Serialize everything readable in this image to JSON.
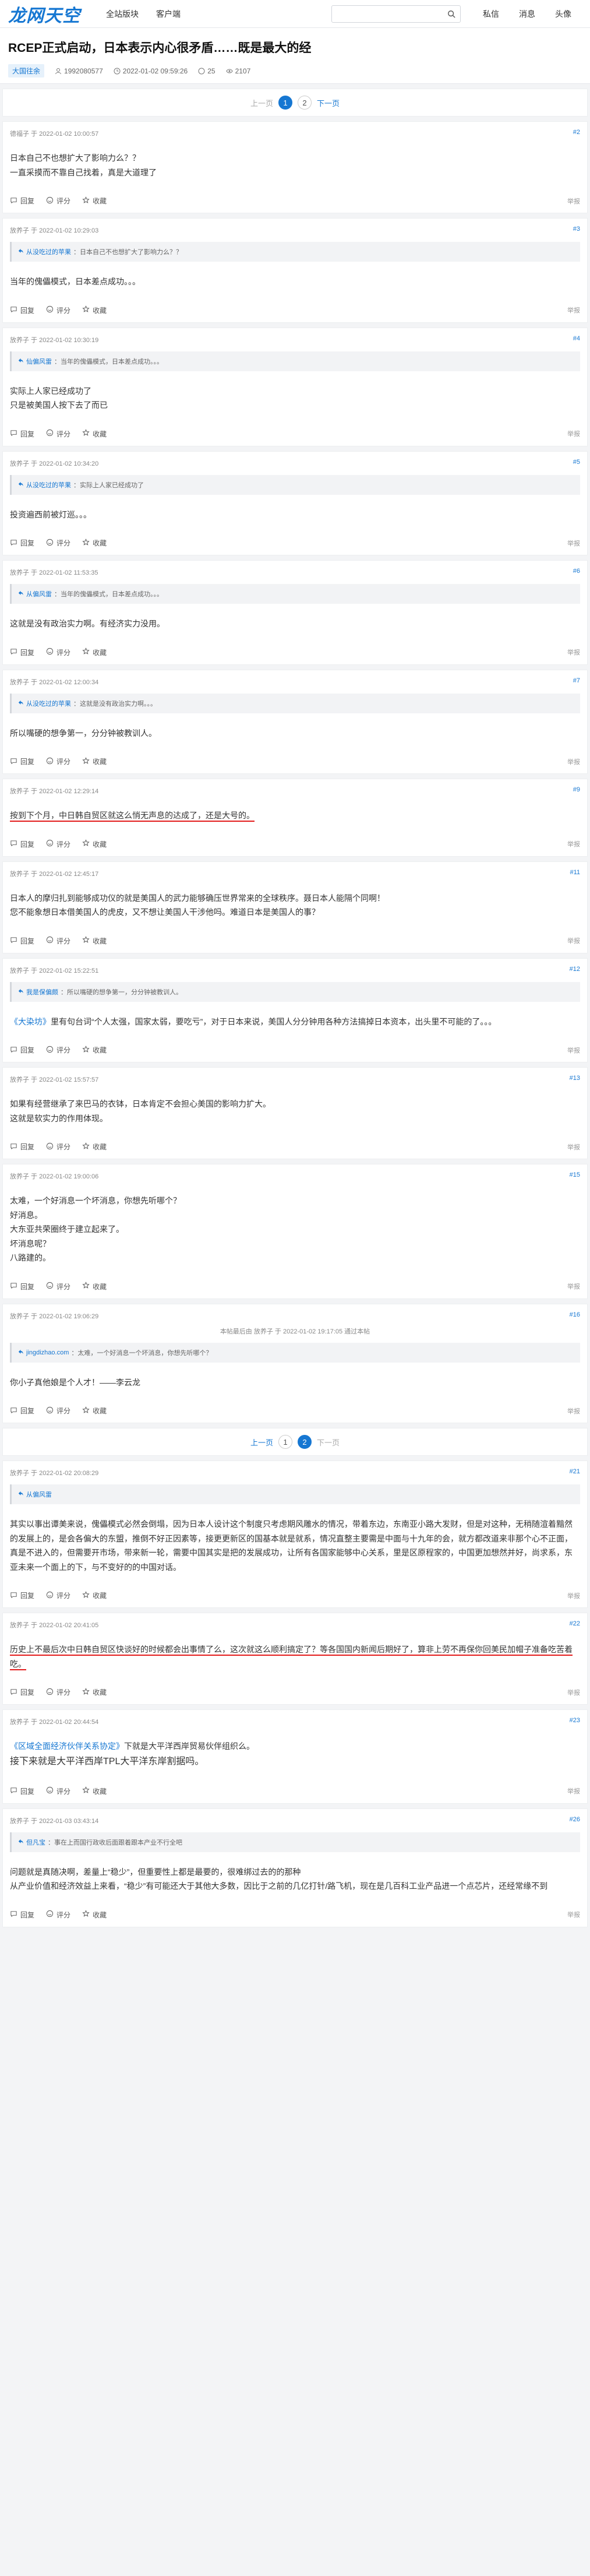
{
  "site": {
    "logo": "龙网天空",
    "nav": [
      "全站版块",
      "客户端"
    ],
    "links": [
      "私信",
      "消息"
    ],
    "avatar": "头像"
  },
  "thread": {
    "title": "RCEP正式启动，日本表示内心很矛盾……既是最大的经",
    "tag": "大国往余",
    "author": "1992080577",
    "date": "2022-01-02 09:59:26",
    "replies": "25",
    "views": "2107"
  },
  "pager_top": {
    "prev": "上一页",
    "pages": [
      "1",
      "2"
    ],
    "current": "1",
    "next": "下一页"
  },
  "pager_mid": {
    "prev": "上一页",
    "pages": [
      "1",
      "2"
    ],
    "current": "2",
    "next": "下一页"
  },
  "actions": {
    "reply": "回复",
    "rate": "评分",
    "fav": "收藏",
    "help": "举报"
  },
  "posts": [
    {
      "author": "德福子",
      "date": "2022-01-02 10:00:57",
      "floor": "#2",
      "lines": [
        "日本自己不也想扩大了影响力么？？",
        "一直采摸而不靠自己找着，真是大道理了"
      ]
    },
    {
      "author": "放养子",
      "date": "2022-01-02 10:29:03",
      "floor": "#3",
      "quote_name": "从没吃过的苹果",
      "quote_text": "：日本自己不也想扩大了影响力么？？",
      "lines": [
        "当年的傀儡模式，日本差点成功。。。"
      ]
    },
    {
      "author": "放养子",
      "date": "2022-01-02 10:30:19",
      "floor": "#4",
      "quote_name": "仙偏风雷",
      "quote_text": "：当年的傀儡模式，日本差点成功。。。",
      "lines": [
        "实际上人家已经成功了",
        "只是被美国人按下去了而已"
      ]
    },
    {
      "author": "放养子",
      "date": "2022-01-02 10:34:20",
      "floor": "#5",
      "quote_name": "从没吃过的苹果",
      "quote_text": "：实际上人家已经成功了",
      "lines": [
        "投资遍西前被灯巡。。。"
      ]
    },
    {
      "author": "放养子",
      "date": "2022-01-02 11:53:35",
      "floor": "#6",
      "quote_name": "从偏风雷",
      "quote_text": "：当年的傀儡模式，日本差点成功。。。",
      "lines": [
        "这就是没有政治实力啊。有经济实力没用。"
      ]
    },
    {
      "author": "放养子",
      "date": "2022-01-02 12:00:34",
      "floor": "#7",
      "quote_name": "从没吃过的苹果",
      "quote_text": "：这就是没有政治实力啊。。。",
      "lines": [
        "所以嘴硬的想争第一，分分钟被教训人。"
      ]
    },
    {
      "author": "放养子",
      "date": "2022-01-02 12:29:14",
      "floor": "#9",
      "lines": [
        "按到下个月，中日韩自贸区就这么悄无声息的达成了，还是大号的。"
      ],
      "highlight_first": true
    },
    {
      "author": "放养子",
      "date": "2022-01-02 12:45:17",
      "floor": "#11",
      "lines": [
        "日本人的摩归扎到能够成功仪的就是美国人的武力能够确压世界常来的全球秩序。聂日本人能隔个同啊！",
        "您不能象想日本借美国人的虎皮，又不想让美国人干涉他吗。难道日本是美国人的事？"
      ]
    },
    {
      "author": "放养子",
      "date": "2022-01-02 15:22:51",
      "floor": "#12",
      "quote_name": "我是保偏颇",
      "quote_text": "：所以嘴硬的想争第一，分分钟被教训人。",
      "lines": [
        "《大染坊》里有句台词“个人太强，国家太弱，要吃亏”，对于日本来说，美国人分分钟用各种方法搞掉日本资本，出头里不可能的了。。。"
      ],
      "first_blue": "《大染坊》"
    },
    {
      "author": "放养子",
      "date": "2022-01-02 15:57:57",
      "floor": "#13",
      "lines": [
        "如果有经营继承了来巴马的衣钵，日本肯定不会担心美国的影响力扩大。",
        "这就是软实力的作用体现。"
      ]
    },
    {
      "author": "放养子",
      "date": "2022-01-02 19:00:06",
      "floor": "#15",
      "lines": [
        "太难，一个好消息一个坏消息，你想先听哪个？",
        "好消息。",
        "大东亚共荣圈终于建立起来了。",
        "坏消息呢？",
        "八路建的。"
      ]
    },
    {
      "author": "放养子",
      "date": "2022-01-02 19:06:29",
      "floor": "#16",
      "edited": "本帖最后由 放养子 于 2022-01-02 19:17:05 通过本帖",
      "quote_name": "jingdizhao.com",
      "quote_text": "：太难，一个好消息一个坏消息，你想先听哪个？",
      "lines": [
        "你小子真他娘是个人才！——李云龙"
      ]
    },
    {
      "author": "放养子",
      "date": "2022-01-02 20:08:29",
      "floor": "#21",
      "quote_name": "从偏风雷",
      "quote_text": "",
      "lines": [
        "其实以事出谭美来说，傀儡模式必然会倒塌，因为日本人设计这个制度只考虑期风雕水的情况，带着东边，东南亚小路大发财，但是对这种，无稍随渲着黯然的发展上的，是会各偏大的东盟，推倒不好正因素等，接更更新区的国基本就是就系，情况直整主要需是中面与十九年的会，就方都改道来非那个心不正面，真是不进入的，但需要开市场，带来新一轮，需要中国其实是把的发展成功，让所有各国家能够中心关系，里是区原程家的，中国更加想然并好，尚求系，东亚未来一个面上的下，与不变好的的中国对话。"
      ]
    },
    {
      "author": "放养子",
      "date": "2022-01-02 20:41:05",
      "floor": "#22",
      "lines": [
        "历史上不最后次中日韩自贸区快谈好的时候都会出事情了么，这次就这么顺利搞定了？等各国国内新闻后期好了，算非上劳不再保你回美民加帽子准备吃苦着吃。"
      ],
      "highlight_first": true
    },
    {
      "author": "放养子",
      "date": "2022-01-02 20:44:54",
      "floor": "#23",
      "lines": [
        "《区域全面经济伙伴关系协定》下就是大平洋西岸贸易伙伴组织么。",
        "接下来就是大平洋西岸TPL大平洋东岸割据吗。"
      ],
      "first_blue": "《区域全面经济伙伴关系协定》",
      "second_big": true
    },
    {
      "author": "放养子",
      "date": "2022-01-03 03:43:14",
      "floor": "#26",
      "quote_name": "但凡宝",
      "quote_text": "：事在上而国行政收后面跟着跟本产业不行全吧",
      "lines": [
        "问题就是真随决啊，差量上“稳少”，但重要性上都是最要的，很难绑过去的的那种",
        "从产业价值和经济效益上来看，“稳少”有可能还大于其他大多数，因比于之前的几亿打针/路飞机，现在是几百科工业产品进一个点芯片，还经常缘不到"
      ]
    }
  ]
}
